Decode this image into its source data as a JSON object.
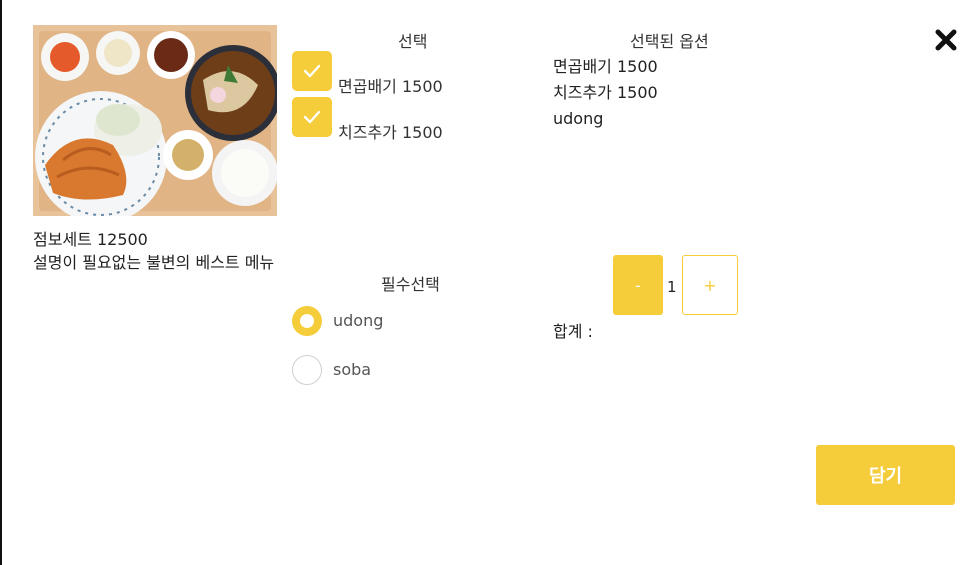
{
  "product": {
    "title": "점보세트 12500",
    "description": "설명이 필요없는 불변의 베스트 메뉴",
    "image_icon": "food-photo"
  },
  "options": {
    "header": "선택",
    "items": [
      {
        "label": "면곱배기 1500",
        "checked": true
      },
      {
        "label": "치즈추가 1500",
        "checked": true
      }
    ]
  },
  "required": {
    "header": "필수선택",
    "choices": [
      {
        "label": "udong",
        "selected": true
      },
      {
        "label": "soba",
        "selected": false
      }
    ]
  },
  "selected": {
    "header": "선택된 옵션",
    "items": [
      "면곱배기 1500",
      "치즈추가 1500",
      "udong"
    ]
  },
  "quantity": {
    "minus": "-",
    "value": "1",
    "plus": "+"
  },
  "total": {
    "label": "합계 :"
  },
  "actions": {
    "add_label": "담기",
    "close_icon": "close-icon"
  },
  "colors": {
    "accent": "#f5cc3a"
  }
}
